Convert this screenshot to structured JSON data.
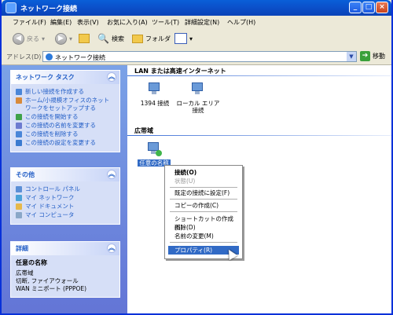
{
  "window": {
    "title": "ネットワーク接続"
  },
  "menubar": [
    "ファイル(F)",
    "編集(E)",
    "表示(V)",
    "お気に入り(A)",
    "ツール(T)",
    "詳細設定(N)",
    "ヘルプ(H)"
  ],
  "toolbar": {
    "back": "戻る",
    "search": "検索",
    "folders": "フォルダ"
  },
  "address": {
    "label": "アドレス(D)",
    "value": "ネットワーク接続",
    "go": "移動"
  },
  "sidebar": {
    "network_tasks": {
      "title": "ネットワーク タスク",
      "items": [
        "新しい接続を作成する",
        "ホーム/小規模オフィスのネットワークをセットアップする",
        "この接続を開始する",
        "この接続の名前を変更する",
        "この接続を削除する",
        "この接続の設定を変更する"
      ]
    },
    "other": {
      "title": "その他",
      "items": [
        "コントロール パネル",
        "マイ ネットワーク",
        "マイ ドキュメント",
        "マイ コンピュータ"
      ]
    },
    "details": {
      "title": "詳細",
      "name": "任意の名称",
      "lines": [
        "広帯域",
        "切断, ファイアウォール",
        "WAN ミニポート (PPPOE)"
      ]
    }
  },
  "content": {
    "group_lan": "LAN または高速インターネット",
    "lan_items": [
      "1394 接続",
      "ローカル エリア接続"
    ],
    "group_broadband": "広帯域",
    "broadband_item": "任意の名称"
  },
  "context_menu": [
    "接続(O)",
    "状態(U)",
    "既定の接続に設定(F)",
    "コピーの作成(C)",
    "ショートカットの作成(S)",
    "削除(D)",
    "名前の変更(M)",
    "プロパティ(R)"
  ]
}
